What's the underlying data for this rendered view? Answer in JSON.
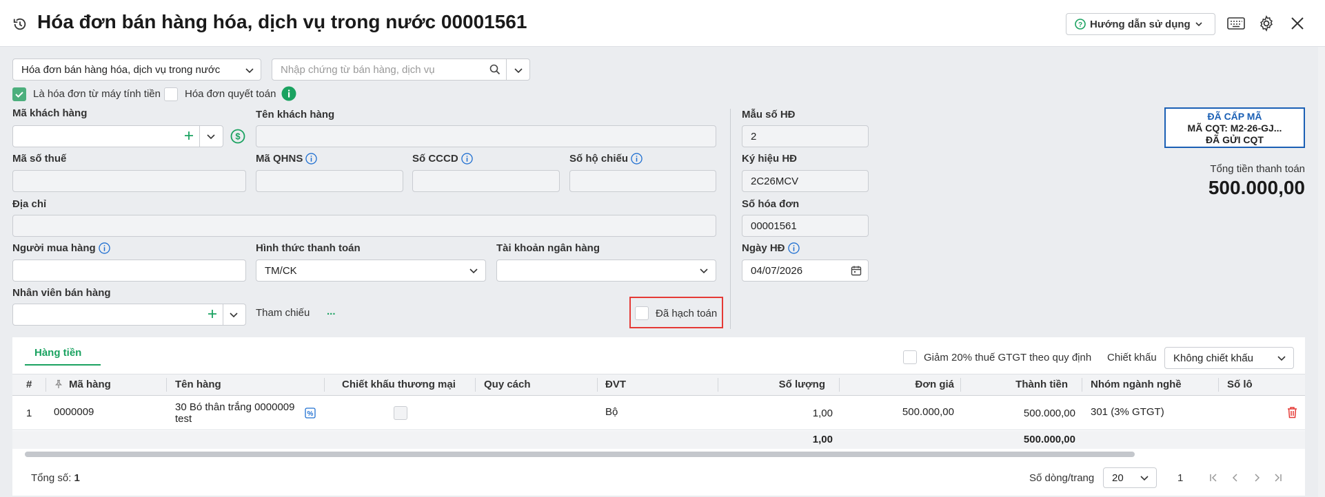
{
  "header": {
    "title": "Hóa đơn bán hàng hóa, dịch vụ trong nước 00001561",
    "help_label": "Hướng dẫn sử dụng"
  },
  "top": {
    "invoice_type": "Hóa đơn bán hàng hóa, dịch vụ trong nước",
    "search_placeholder": "Nhập chứng từ bán hàng, dịch vụ",
    "cash_register_label": "Là hóa đơn từ máy tính tiền",
    "cash_register_checked": true,
    "settlement_label": "Hóa đơn quyết toán",
    "settlement_checked": false
  },
  "form": {
    "customer_code_label": "Mã khách hàng",
    "customer_name_label": "Tên khách hàng",
    "tax_code_label": "Mã số thuế",
    "qhns_label": "Mã QHNS",
    "cccd_label": "Số CCCD",
    "passport_label": "Số hộ chiếu",
    "address_label": "Địa chỉ",
    "buyer_label": "Người mua hàng",
    "payment_method_label": "Hình thức thanh toán",
    "payment_method_value": "TM/CK",
    "bank_account_label": "Tài khoản ngân hàng",
    "salesperson_label": "Nhân viên bán hàng",
    "reference_label": "Tham chiếu",
    "reference_more": "...",
    "posted_label": "Đã hạch toán",
    "posted_checked": false
  },
  "invoice_info": {
    "template_label": "Mẫu số HĐ",
    "template_value": "2",
    "symbol_label": "Ký hiệu HĐ",
    "symbol_value": "2C26MCV",
    "number_label": "Số hóa đơn",
    "number_value": "00001561",
    "date_label": "Ngày HĐ",
    "date_value": "04/07/2026"
  },
  "status": {
    "line1": "ĐÃ CẤP MÃ",
    "line2": "MÃ CQT: M2-26-GJ...",
    "line3": "ĐÃ GỬI CQT",
    "total_label": "Tổng tiền thanh toán",
    "total_value": "500.000,00"
  },
  "grid": {
    "tab_label": "Hàng tiền",
    "vat_reduce_label": "Giảm 20% thuế GTGT theo quy định",
    "discount_label": "Chiết khấu",
    "discount_value": "Không chiết khấu",
    "columns": [
      "#",
      "Mã hàng",
      "Tên hàng",
      "Chiết khấu thương mại",
      "Quy cách",
      "ĐVT",
      "Số lượng",
      "Đơn giá",
      "Thành tiền",
      "Nhóm ngành nghề",
      "Số lô"
    ],
    "rows": [
      {
        "index": "1",
        "code": "0000009",
        "name_line1": "30 Bó thân trắng 0000009",
        "name_line2": "test",
        "discount_checked": false,
        "spec": "",
        "unit": "Bộ",
        "qty": "1,00",
        "price": "500.000,00",
        "amount": "500.000,00",
        "group": "301 (3% GTGT)",
        "lot": ""
      }
    ],
    "total_qty": "1,00",
    "total_amount": "500.000,00"
  },
  "footer": {
    "total_label": "Tổng số:",
    "total_count": "1",
    "page_size_label": "Số dòng/trang",
    "page_size_value": "20",
    "current_page": "1"
  },
  "colors": {
    "accent_green": "#1aa260",
    "info_blue": "#1f6fd1",
    "status_blue": "#1a5fb4",
    "highlight_red": "#e53935",
    "delete_red": "#e53935"
  }
}
